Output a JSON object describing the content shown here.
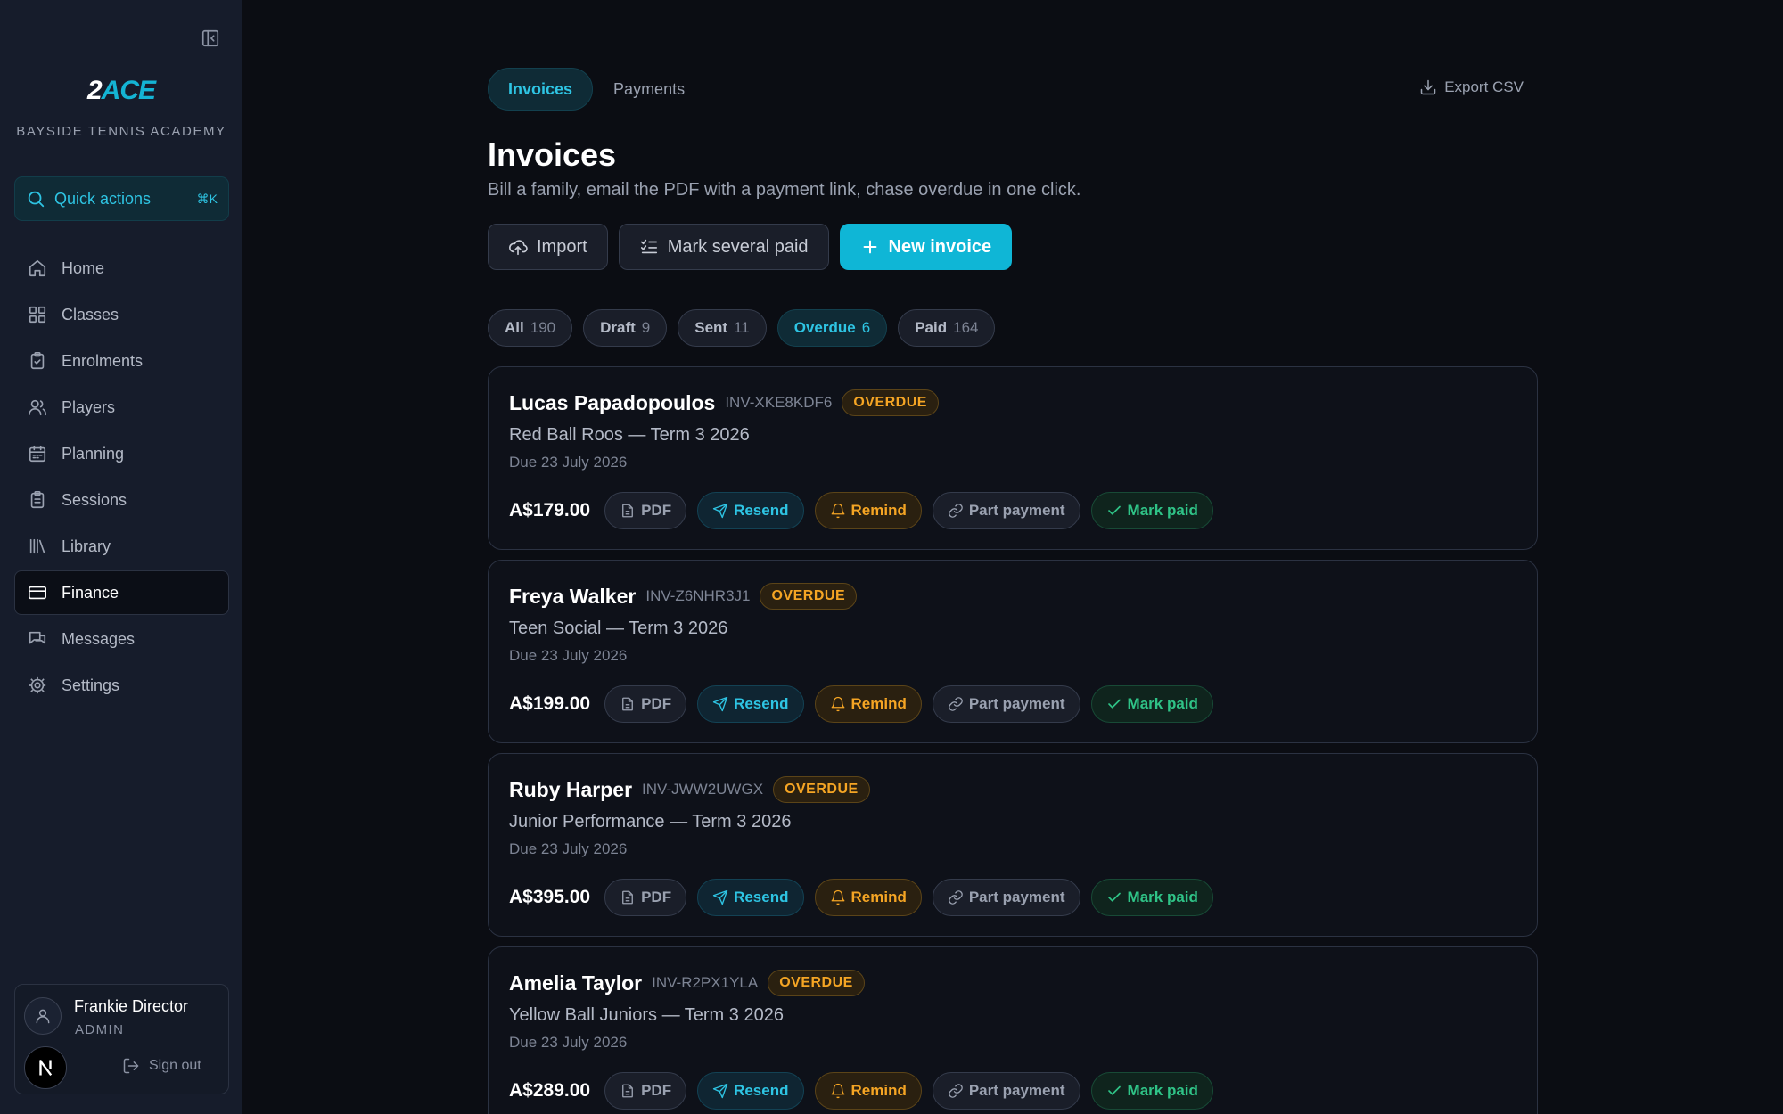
{
  "sidebar": {
    "logo_part1": "2",
    "logo_part2": "ACE",
    "org_name": "BAYSIDE TENNIS ACADEMY",
    "quick_actions": {
      "label": "Quick actions",
      "shortcut": "⌘K"
    },
    "items": [
      {
        "label": "Home",
        "icon": "home-icon"
      },
      {
        "label": "Classes",
        "icon": "grid-icon"
      },
      {
        "label": "Enrolments",
        "icon": "clipboard-check-icon"
      },
      {
        "label": "Players",
        "icon": "users-icon"
      },
      {
        "label": "Planning",
        "icon": "calendar-icon"
      },
      {
        "label": "Sessions",
        "icon": "clipboard-list-icon"
      },
      {
        "label": "Library",
        "icon": "library-icon"
      },
      {
        "label": "Finance",
        "icon": "credit-card-icon",
        "active": true
      },
      {
        "label": "Messages",
        "icon": "messages-icon"
      },
      {
        "label": "Settings",
        "icon": "gear-icon"
      }
    ],
    "user": {
      "name": "Frankie Director",
      "role": "ADMIN",
      "sign_out": "Sign out",
      "badge": "N"
    }
  },
  "tabs": [
    {
      "label": "Invoices",
      "active": true
    },
    {
      "label": "Payments",
      "active": false
    }
  ],
  "export_label": "Export CSV",
  "page": {
    "title": "Invoices",
    "subtitle": "Bill a family, email the PDF with a payment link, chase overdue in one click."
  },
  "actions": {
    "import": "Import",
    "mark_several_paid": "Mark several paid",
    "new_invoice": "New invoice"
  },
  "filters": [
    {
      "label": "All",
      "count": "190"
    },
    {
      "label": "Draft",
      "count": "9"
    },
    {
      "label": "Sent",
      "count": "11"
    },
    {
      "label": "Overdue",
      "count": "6",
      "active": true
    },
    {
      "label": "Paid",
      "count": "164"
    }
  ],
  "card_actions": {
    "pdf": "PDF",
    "resend": "Resend",
    "remind": "Remind",
    "part_payment": "Part payment",
    "mark_paid": "Mark paid"
  },
  "invoices": [
    {
      "name": "Lucas Papadopoulos",
      "ref": "INV-XKE8KDF6",
      "status": "OVERDUE",
      "course": "Red Ball Roos — Term 3 2026",
      "due": "Due 23 July 2026",
      "amount": "A$179.00"
    },
    {
      "name": "Freya Walker",
      "ref": "INV-Z6NHR3J1",
      "status": "OVERDUE",
      "course": "Teen Social — Term 3 2026",
      "due": "Due 23 July 2026",
      "amount": "A$199.00"
    },
    {
      "name": "Ruby Harper",
      "ref": "INV-JWW2UWGX",
      "status": "OVERDUE",
      "course": "Junior Performance — Term 3 2026",
      "due": "Due 23 July 2026",
      "amount": "A$395.00"
    },
    {
      "name": "Amelia Taylor",
      "ref": "INV-R2PX1YLA",
      "status": "OVERDUE",
      "course": "Yellow Ball Juniors — Term 3 2026",
      "due": "Due 23 July 2026",
      "amount": "A$289.00"
    }
  ],
  "colors": {
    "accent": "#0fb6d6",
    "overdue": "#f5a524",
    "paid": "#2fc387",
    "background": "#0b0d13",
    "sidebar": "#161c2b"
  }
}
